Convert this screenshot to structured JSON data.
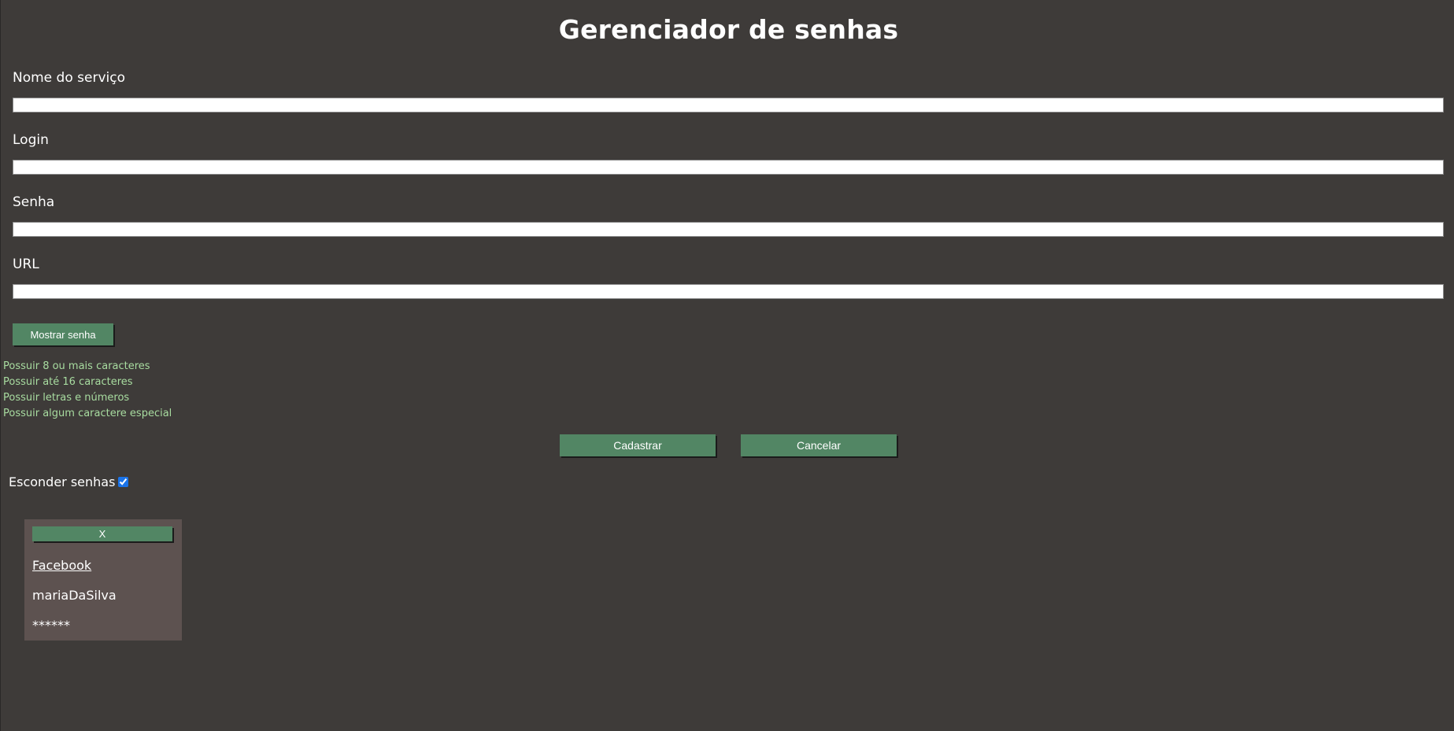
{
  "page": {
    "title": "Gerenciador de senhas"
  },
  "form": {
    "service_name": {
      "label": "Nome do serviço",
      "value": ""
    },
    "login": {
      "label": "Login",
      "value": ""
    },
    "password": {
      "label": "Senha",
      "value": ""
    },
    "url": {
      "label": "URL",
      "value": ""
    },
    "show_password_button": "Mostrar senha"
  },
  "password_rules": [
    "Possuir 8 ou mais caracteres",
    "Possuir até 16 caracteres",
    "Possuir letras e números",
    "Possuir algum caractere especial"
  ],
  "actions": {
    "register_label": "Cadastrar",
    "cancel_label": "Cancelar"
  },
  "hide_passwords": {
    "label": "Esconder senhas",
    "checked": true
  },
  "saved_entries": [
    {
      "remove_label": "X",
      "service": "Facebook",
      "login": "mariaDaSilva",
      "password": "******"
    }
  ],
  "colors": {
    "background": "#3e3b39",
    "button": "#528664",
    "rule_text": "#a8dca0",
    "card": "#5d5250"
  }
}
